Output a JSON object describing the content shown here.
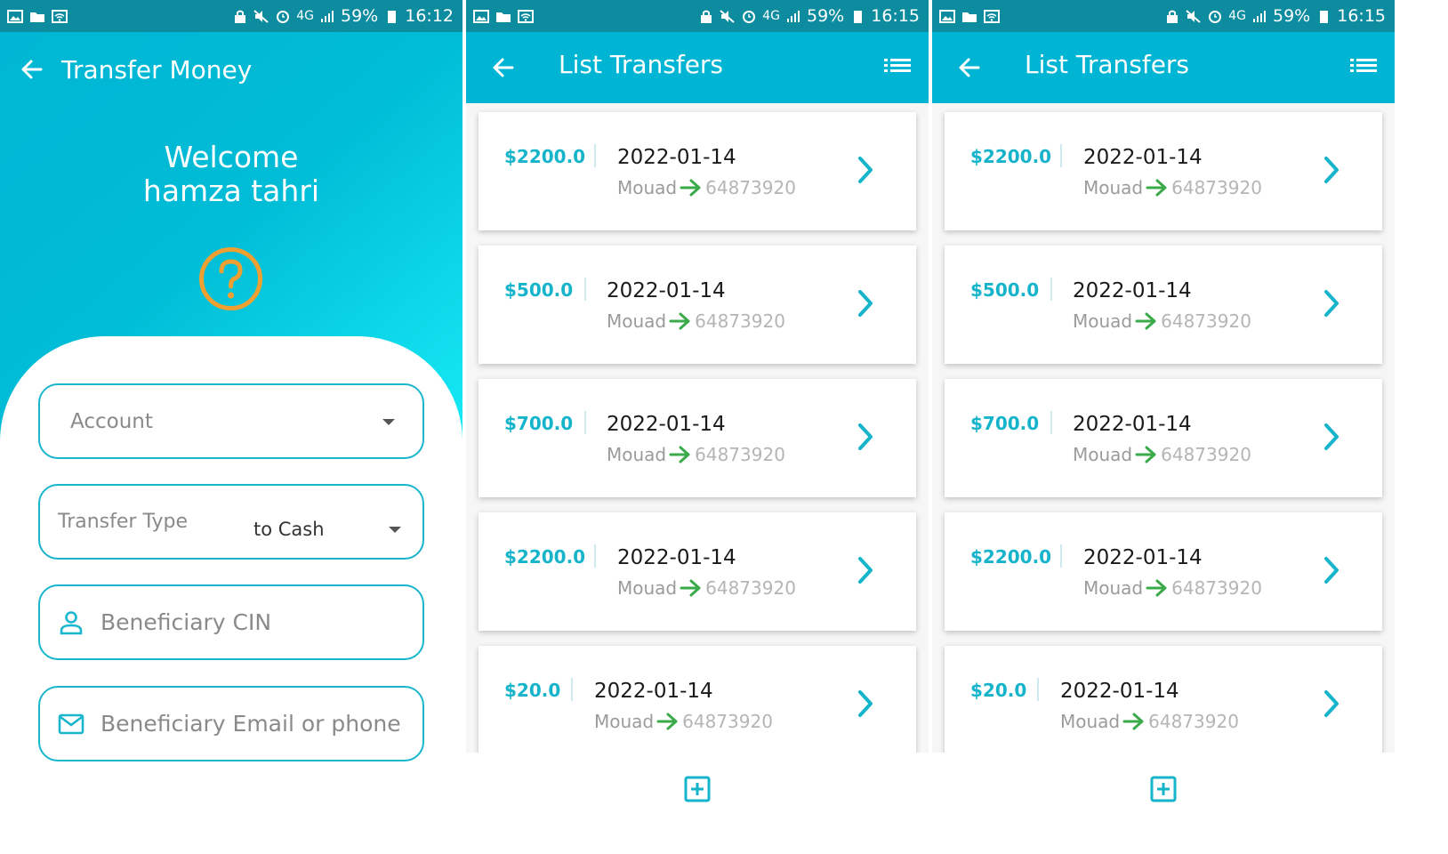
{
  "status_bars": [
    {
      "battery": "59%",
      "time": "16:12",
      "network": "4G"
    },
    {
      "battery": "59%",
      "time": "16:15",
      "network": "4G"
    },
    {
      "battery": "59%",
      "time": "16:15",
      "network": "4G"
    }
  ],
  "transfer_screen": {
    "title": "Transfer Money",
    "welcome_line": "Welcome",
    "user_name": "hamza tahri",
    "help_icon": "question-circle-icon",
    "account_field": {
      "placeholder": "Account"
    },
    "transfer_type_field": {
      "label": "Transfer Type",
      "value": "to Cash"
    },
    "beneficiary_cin_field": {
      "placeholder": "Beneficiary CIN",
      "icon": "person-icon"
    },
    "beneficiary_contact_field": {
      "placeholder": "Beneficiary Email or phone",
      "icon": "mail-icon"
    }
  },
  "list_screens": [
    {
      "title": "List Transfers",
      "transfers": [
        {
          "amount": "$2200.0",
          "date": "2022-01-14",
          "sender": "Mouad",
          "recipient": "64873920"
        },
        {
          "amount": "$500.0",
          "date": "2022-01-14",
          "sender": "Mouad",
          "recipient": "64873920"
        },
        {
          "amount": "$700.0",
          "date": "2022-01-14",
          "sender": "Mouad",
          "recipient": "64873920"
        },
        {
          "amount": "$2200.0",
          "date": "2022-01-14",
          "sender": "Mouad",
          "recipient": "64873920"
        },
        {
          "amount": "$20.0",
          "date": "2022-01-14",
          "sender": "Mouad",
          "recipient": "64873920"
        }
      ]
    },
    {
      "title": "List Transfers",
      "transfers": [
        {
          "amount": "$2200.0",
          "date": "2022-01-14",
          "sender": "Mouad",
          "recipient": "64873920"
        },
        {
          "amount": "$500.0",
          "date": "2022-01-14",
          "sender": "Mouad",
          "recipient": "64873920"
        },
        {
          "amount": "$700.0",
          "date": "2022-01-14",
          "sender": "Mouad",
          "recipient": "64873920"
        },
        {
          "amount": "$2200.0",
          "date": "2022-01-14",
          "sender": "Mouad",
          "recipient": "64873920"
        },
        {
          "amount": "$20.0",
          "date": "2022-01-14",
          "sender": "Mouad",
          "recipient": "64873920"
        }
      ]
    }
  ],
  "colors": {
    "primary": "#00b4d4",
    "status_bar": "#0d8c9f",
    "accent_orange": "#f0a030",
    "accent_green": "#3aaa4a",
    "amount_text": "#16b4cb"
  },
  "icons": {
    "back": "arrow-left-icon",
    "menu": "list-icon",
    "chevron": "chevron-right-icon",
    "add": "add-box-icon",
    "transfer_arrow": "arrow-right-icon"
  }
}
